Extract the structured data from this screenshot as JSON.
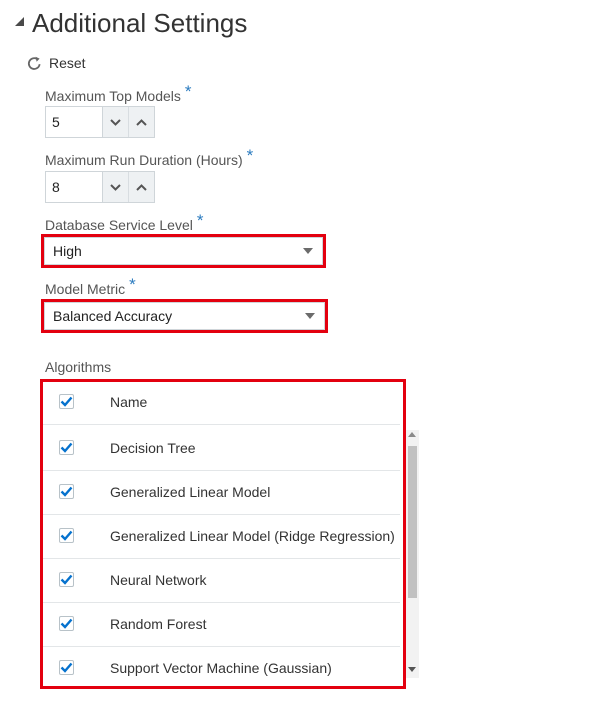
{
  "section": {
    "title": "Additional Settings"
  },
  "reset": {
    "label": "Reset"
  },
  "fields": {
    "max_top_models": {
      "label": "Maximum Top Models",
      "required_mark": "*",
      "value": "5"
    },
    "max_run_duration": {
      "label": "Maximum Run Duration (Hours)",
      "required_mark": "*",
      "value": "8"
    },
    "db_service_level": {
      "label": "Database Service Level",
      "required_mark": "*",
      "value": "High"
    },
    "model_metric": {
      "label": "Model Metric",
      "required_mark": "*",
      "value": "Balanced Accuracy"
    }
  },
  "algorithms": {
    "label": "Algorithms",
    "header": "Name",
    "header_checked": true,
    "rows": [
      {
        "name": "Decision Tree",
        "checked": true
      },
      {
        "name": "Generalized Linear Model",
        "checked": true
      },
      {
        "name": "Generalized Linear Model (Ridge Regression)",
        "checked": true
      },
      {
        "name": "Neural Network",
        "checked": true
      },
      {
        "name": "Random Forest",
        "checked": true
      },
      {
        "name": "Support Vector Machine (Gaussian)",
        "checked": true
      }
    ]
  },
  "colors": {
    "accent": "#0572ce",
    "highlight": "#e3000f",
    "required": "#2b7bbf"
  }
}
